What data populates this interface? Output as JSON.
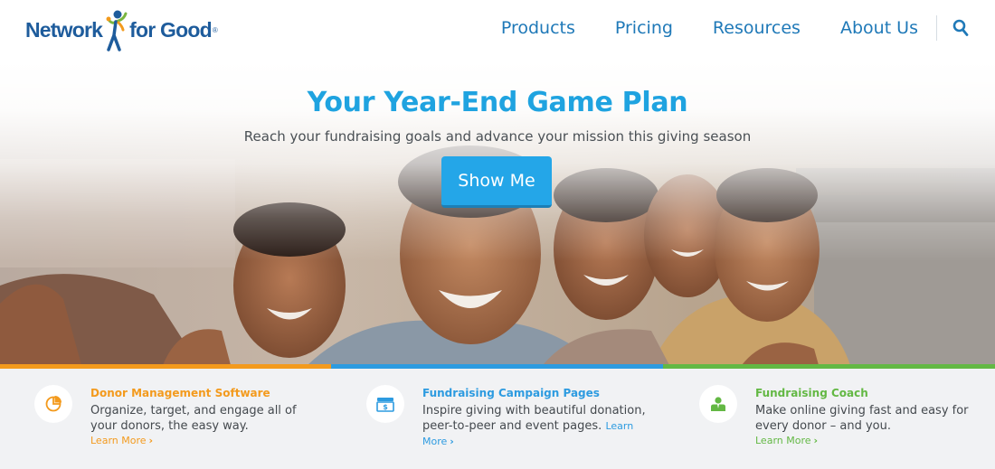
{
  "brand": {
    "part1": "Network",
    "part2": "for Good",
    "reg": "®",
    "color_blue": "#1e5c9c",
    "color_green": "#7ab53f",
    "color_orange": "#f39a1d"
  },
  "nav": {
    "items": [
      "Products",
      "Pricing",
      "Resources",
      "About Us"
    ],
    "search_icon": "search-icon",
    "color": "#1f79b8"
  },
  "hero": {
    "title": "Your Year-End Game Plan",
    "subtitle": "Reach your fundraising goals and advance your mission this giving season",
    "button": "Show Me",
    "title_color": "#1fa3e0",
    "button_color": "#24a6e8"
  },
  "bars": [
    "#f39a1d",
    "#2d9be0",
    "#63b844"
  ],
  "features": [
    {
      "icon": "pie-chart-icon",
      "title": "Donor Management Software",
      "desc": "Organize, target, and engage all of your donors, the easy way.",
      "link": "Learn More",
      "color": "#f39a1d"
    },
    {
      "icon": "money-icon",
      "title": "Fundraising Campaign Pages",
      "desc": "Inspire giving with beautiful donation, peer-to-peer and event pages.",
      "link": "Learn More",
      "color": "#2d9be0"
    },
    {
      "icon": "person-icon",
      "title": "Fundraising Coach",
      "desc": "Make online giving fast and easy for every donor – and you.",
      "link": "Learn More",
      "color": "#63b844"
    }
  ]
}
